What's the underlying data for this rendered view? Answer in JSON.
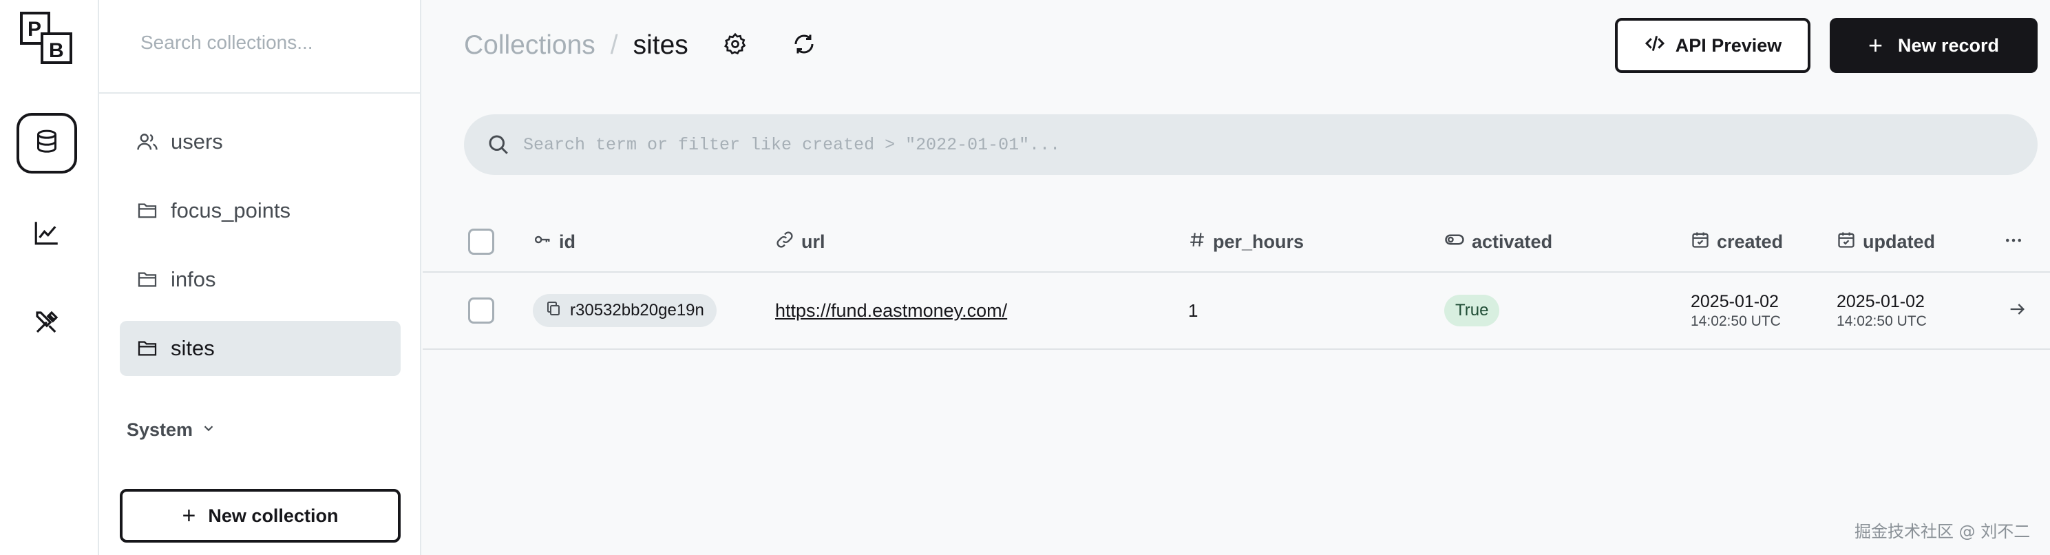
{
  "logo": {
    "line1": "P",
    "line2": "B"
  },
  "rail": {
    "items": [
      {
        "name": "collections",
        "icon": "database-icon",
        "active": true
      },
      {
        "name": "logs",
        "icon": "chart-line-icon",
        "active": false
      },
      {
        "name": "settings",
        "icon": "tools-icon",
        "active": false
      }
    ]
  },
  "sidebar": {
    "search_placeholder": "Search collections...",
    "collections": [
      {
        "label": "users",
        "icon": "users-icon",
        "active": false
      },
      {
        "label": "focus_points",
        "icon": "folder-icon",
        "active": false
      },
      {
        "label": "infos",
        "icon": "folder-icon",
        "active": false
      },
      {
        "label": "sites",
        "icon": "folder-icon",
        "active": true
      }
    ],
    "system_label": "System",
    "new_collection_plus": "+",
    "new_collection_label": "New collection"
  },
  "header": {
    "breadcrumb_parent": "Collections",
    "breadcrumb_sep": "/",
    "breadcrumb_current": "sites",
    "api_preview_label": "API Preview",
    "new_record_plus": "+",
    "new_record_label": "New record"
  },
  "search": {
    "placeholder": "Search term or filter like created > \"2022-01-01\"..."
  },
  "table": {
    "columns": [
      {
        "label": "id",
        "icon": "key-icon"
      },
      {
        "label": "url",
        "icon": "link-icon"
      },
      {
        "label": "per_hours",
        "icon": "hash-icon"
      },
      {
        "label": "activated",
        "icon": "toggle-icon"
      },
      {
        "label": "created",
        "icon": "calendar-icon"
      },
      {
        "label": "updated",
        "icon": "calendar-icon"
      }
    ],
    "rows": [
      {
        "id": "r30532bb20ge19n",
        "url": "https://fund.eastmoney.com/",
        "per_hours": "1",
        "activated": "True",
        "created_date": "2025-01-02",
        "created_time": "14:02:50 UTC",
        "updated_date": "2025-01-02",
        "updated_time": "14:02:50 UTC"
      }
    ]
  },
  "watermark": "掘金技术社区 @ 刘不二",
  "colors": {
    "dark": "#16161a",
    "muted": "#a6afb6",
    "surface": "#e4e9ec",
    "success_bg": "#d8efe0"
  }
}
